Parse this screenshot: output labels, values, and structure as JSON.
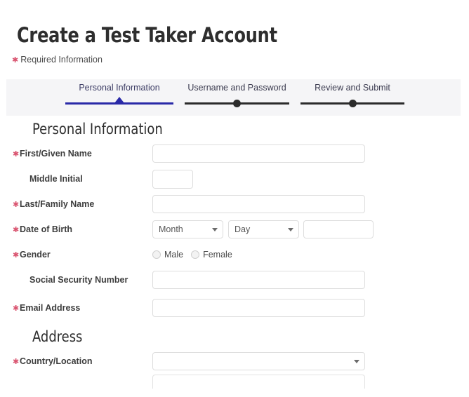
{
  "header": {
    "title": "Create a Test Taker Account",
    "required_note": "Required Information",
    "required_marker": "✱"
  },
  "stepper": {
    "steps": [
      {
        "label": "Personal Information",
        "state": "active"
      },
      {
        "label": "Username and Password",
        "state": "inactive"
      },
      {
        "label": "Review and Submit",
        "state": "inactive"
      }
    ],
    "active_color": "#2a2aa8",
    "inactive_color": "#2b2b2b",
    "band_color": "#f5f5f7"
  },
  "sections": {
    "personal": {
      "heading": "Personal Information"
    },
    "address": {
      "heading": "Address"
    }
  },
  "fields": {
    "first_name": {
      "label": "First/Given Name",
      "required": true,
      "value": "",
      "placeholder": ""
    },
    "middle_initial": {
      "label": "Middle Initial",
      "required": false,
      "value": "",
      "placeholder": ""
    },
    "last_name": {
      "label": "Last/Family Name",
      "required": true,
      "value": "",
      "placeholder": ""
    },
    "dob": {
      "label": "Date of Birth",
      "required": true,
      "month_value": "Month",
      "day_value": "Day",
      "year_value": "",
      "year_placeholder": ""
    },
    "gender": {
      "label": "Gender",
      "required": true,
      "options": [
        {
          "label": "Male",
          "selected": false
        },
        {
          "label": "Female",
          "selected": false
        }
      ]
    },
    "ssn": {
      "label": "Social Security Number",
      "required": false,
      "value": "",
      "placeholder": ""
    },
    "email": {
      "label": "Email Address",
      "required": true,
      "value": "",
      "placeholder": ""
    },
    "country": {
      "label": "Country/Location",
      "required": true,
      "value": ""
    }
  },
  "colors": {
    "required_star": "#d9536f",
    "label_text": "#3d3d3d",
    "input_border": "#dddddd"
  }
}
